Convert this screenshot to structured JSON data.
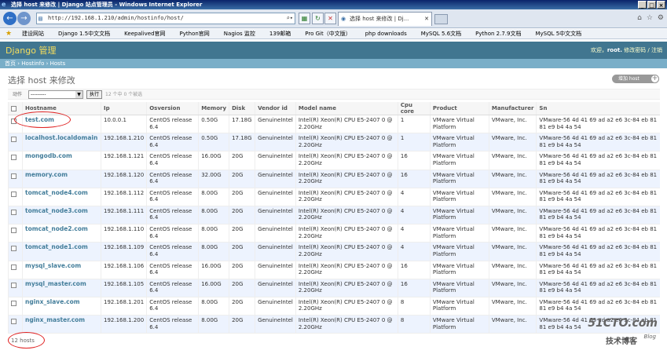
{
  "window": {
    "title": "选择 host 来修改 | Django 站点管理员 - Windows Internet Explorer",
    "min_icon": "minimize-icon",
    "max_icon": "maximize-icon",
    "close_icon": "close-icon"
  },
  "browser": {
    "address": "http://192.168.1.210/admin/hostinfo/host/",
    "tab_label": "选择 host 来修改 | Dj...",
    "tab_close": "✕",
    "favorites": [
      "建设网站",
      "Django 1.5中文文档",
      "Keepalived官网",
      "Python官网",
      "Nagios 监控",
      "139邮箱",
      "Pro Git（中文版）",
      "php downloads",
      "MySQL 5.6文档",
      "Python 2.7.9文档",
      "MySQL 5中文文档"
    ]
  },
  "admin": {
    "brand": "Django 管理",
    "welcome": "欢迎，",
    "username": "root.",
    "change_password": "修改密码",
    "sep": "/",
    "logout": "注销",
    "breadcrumbs": [
      "首页",
      "Hostinfo",
      "Hosts"
    ],
    "crumb_sep": "›",
    "page_title": "选择 host 来修改",
    "add_label": "增加 host",
    "add_plus": "+",
    "action_label": "动作",
    "action_default": "---------",
    "action_go": "执行",
    "selection_count": "12 个中 0 个被选",
    "paginator": "12 hosts"
  },
  "table": {
    "columns": [
      "Hostname",
      "Ip",
      "Osversion",
      "Memory",
      "Disk",
      "Vendor id",
      "Model name",
      "Cpu core",
      "Product",
      "Manufacturer",
      "Sn"
    ],
    "rows": [
      {
        "hostname": "test.com",
        "ip": "10.0.0.1",
        "os": "CentOS release 6.4",
        "mem": "0.50G",
        "disk": "17.18G",
        "vendor": "GenuineIntel",
        "model": "Intel(R) Xeon(R) CPU E5-2407 0 @ 2.20GHz",
        "cpu": "1",
        "product": "VMware Virtual Platform",
        "mfr": "VMware, Inc.",
        "sn": "VMware-56 4d 41 69 ad a2 e6 3c-84 eb 81 81 e9 b4 4a 54"
      },
      {
        "hostname": "localhost.localdomain",
        "ip": "192.168.1.210",
        "os": "CentOS release 6.4",
        "mem": "0.50G",
        "disk": "17.18G",
        "vendor": "GenuineIntel",
        "model": "Intel(R) Xeon(R) CPU E5-2407 0 @ 2.20GHz",
        "cpu": "1",
        "product": "VMware Virtual Platform",
        "mfr": "VMware, Inc.",
        "sn": "VMware-56 4d 41 69 ad a2 e6 3c-84 eb 81 81 e9 b4 4a 54"
      },
      {
        "hostname": "mongodb.com",
        "ip": "192.168.1.121",
        "os": "CentOS release 6.4",
        "mem": "16.00G",
        "disk": "20G",
        "vendor": "GenuineIntel",
        "model": "Intel(R) Xeon(R) CPU E5-2407 0 @ 2.20GHz",
        "cpu": "16",
        "product": "VMware Virtual Platform",
        "mfr": "VMware, Inc.",
        "sn": "VMware-56 4d 41 69 ad a2 e6 3c-84 eb 81 81 e9 b4 4a 54"
      },
      {
        "hostname": "memory.com",
        "ip": "192.168.1.120",
        "os": "CentOS release 6.4",
        "mem": "32.00G",
        "disk": "20G",
        "vendor": "GenuineIntel",
        "model": "Intel(R) Xeon(R) CPU E5-2407 0 @ 2.20GHz",
        "cpu": "16",
        "product": "VMware Virtual Platform",
        "mfr": "VMware, Inc.",
        "sn": "VMware-56 4d 41 69 ad a2 e6 3c-84 eb 81 81 e9 b4 4a 54"
      },
      {
        "hostname": "tomcat_node4.com",
        "ip": "192.168.1.112",
        "os": "CentOS release 6.4",
        "mem": "8.00G",
        "disk": "20G",
        "vendor": "GenuineIntel",
        "model": "Intel(R) Xeon(R) CPU E5-2407 0 @ 2.20GHz",
        "cpu": "4",
        "product": "VMware Virtual Platform",
        "mfr": "VMware, Inc.",
        "sn": "VMware-56 4d 41 69 ad a2 e6 3c-84 eb 81 81 e9 b4 4a 54"
      },
      {
        "hostname": "tomcat_node3.com",
        "ip": "192.168.1.111",
        "os": "CentOS release 6.4",
        "mem": "8.00G",
        "disk": "20G",
        "vendor": "GenuineIntel",
        "model": "Intel(R) Xeon(R) CPU E5-2407 0 @ 2.20GHz",
        "cpu": "4",
        "product": "VMware Virtual Platform",
        "mfr": "VMware, Inc.",
        "sn": "VMware-56 4d 41 69 ad a2 e6 3c-84 eb 81 81 e9 b4 4a 54"
      },
      {
        "hostname": "tomcat_node2.com",
        "ip": "192.168.1.110",
        "os": "CentOS release 6.4",
        "mem": "8.00G",
        "disk": "20G",
        "vendor": "GenuineIntel",
        "model": "Intel(R) Xeon(R) CPU E5-2407 0 @ 2.20GHz",
        "cpu": "4",
        "product": "VMware Virtual Platform",
        "mfr": "VMware, Inc.",
        "sn": "VMware-56 4d 41 69 ad a2 e6 3c-84 eb 81 81 e9 b4 4a 54"
      },
      {
        "hostname": "tomcat_node1.com",
        "ip": "192.168.1.109",
        "os": "CentOS release 6.4",
        "mem": "8.00G",
        "disk": "20G",
        "vendor": "GenuineIntel",
        "model": "Intel(R) Xeon(R) CPU E5-2407 0 @ 2.20GHz",
        "cpu": "4",
        "product": "VMware Virtual Platform",
        "mfr": "VMware, Inc.",
        "sn": "VMware-56 4d 41 69 ad a2 e6 3c-84 eb 81 81 e9 b4 4a 54"
      },
      {
        "hostname": "mysql_slave.com",
        "ip": "192.168.1.106",
        "os": "CentOS release 6.4",
        "mem": "16.00G",
        "disk": "20G",
        "vendor": "GenuineIntel",
        "model": "Intel(R) Xeon(R) CPU E5-2407 0 @ 2.20GHz",
        "cpu": "16",
        "product": "VMware Virtual Platform",
        "mfr": "VMware, Inc.",
        "sn": "VMware-56 4d 41 69 ad a2 e6 3c-84 eb 81 81 e9 b4 4a 54"
      },
      {
        "hostname": "mysql_master.com",
        "ip": "192.168.1.105",
        "os": "CentOS release 6.4",
        "mem": "16.00G",
        "disk": "20G",
        "vendor": "GenuineIntel",
        "model": "Intel(R) Xeon(R) CPU E5-2407 0 @ 2.20GHz",
        "cpu": "16",
        "product": "VMware Virtual Platform",
        "mfr": "VMware, Inc.",
        "sn": "VMware-56 4d 41 69 ad a2 e6 3c-84 eb 81 81 e9 b4 4a 54"
      },
      {
        "hostname": "nginx_slave.com",
        "ip": "192.168.1.201",
        "os": "CentOS release 6.4",
        "mem": "8.00G",
        "disk": "20G",
        "vendor": "GenuineIntel",
        "model": "Intel(R) Xeon(R) CPU E5-2407 0 @ 2.20GHz",
        "cpu": "8",
        "product": "VMware Virtual Platform",
        "mfr": "VMware, Inc.",
        "sn": "VMware-56 4d 41 69 ad a2 e6 3c-84 eb 81 81 e9 b4 4a 54"
      },
      {
        "hostname": "nginx_master.com",
        "ip": "192.168.1.200",
        "os": "CentOS release 6.4",
        "mem": "8.00G",
        "disk": "20G",
        "vendor": "GenuineIntel",
        "model": "Intel(R) Xeon(R) CPU E5-2407 0 @ 2.20GHz",
        "cpu": "8",
        "product": "VMware Virtual Platform",
        "mfr": "VMware, Inc.",
        "sn": "VMware-56 4d 41 69 ad a2 e6 3c-84 eb 81 81 e9 b4 4a 54"
      }
    ]
  },
  "watermark": {
    "line1": "51CTO.com",
    "line2": "技术博客",
    "line3": "Blog"
  },
  "colors": {
    "header_bg": "#417690",
    "breadcrumb_bg": "#79aec8",
    "link": "#447e9b",
    "annotation": "#e02020"
  }
}
